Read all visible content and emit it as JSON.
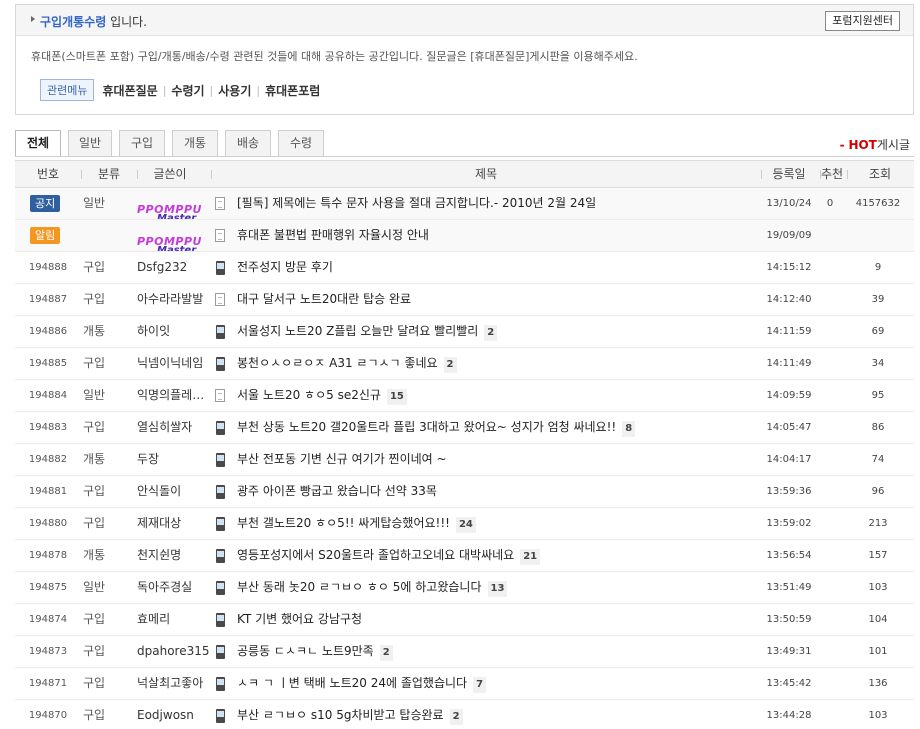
{
  "info": {
    "title_link": "구입개통수령",
    "title_suffix": " 입니다.",
    "forum_center_button": "포럼지원센터",
    "description": "휴대폰(스마트폰 포함) 구입/개통/배송/수령 관련된 것들에 대해 공유하는 공간입니다. 질문글은 [휴대폰질문]게시판을 이용해주세요.",
    "related_menu_label": "관련메뉴",
    "related_menu": [
      "휴대폰질문",
      "수령기",
      "사용기",
      "휴대폰포럼"
    ]
  },
  "tabs": [
    "전체",
    "일반",
    "구입",
    "개통",
    "배송",
    "수령"
  ],
  "hot": {
    "dash": "-",
    "hot": "HOT",
    "suffix": "게시글"
  },
  "columns": [
    "번호",
    "분류",
    "글쓴이",
    "제목",
    "등록일",
    "추천",
    "조회"
  ],
  "admin_logo": {
    "top": "PPOMPPU",
    "bottom": "Master"
  },
  "rows": [
    {
      "num_badge": "공지",
      "badge_type": "gongji",
      "category": "일반",
      "admin": true,
      "icon": "doc",
      "title": "[필독] 제목에는 특수 문자 사용을 절대 금지합니다.- 2010년 2월 24일",
      "comments": "",
      "date": "13/10/24",
      "rec": "0",
      "views": "4157632"
    },
    {
      "num_badge": "알림",
      "badge_type": "alrim",
      "category": "",
      "admin": true,
      "icon": "doc",
      "title": "휴대폰 불편법 판매행위 자율시정 안내",
      "comments": "",
      "date": "19/09/09",
      "rec": "",
      "views": ""
    },
    {
      "num": "194888",
      "category": "구입",
      "author": "Dsfg232",
      "icon": "phone",
      "title": "전주성지 방문 후기",
      "comments": "",
      "date": "14:15:12",
      "rec": "",
      "views": "9"
    },
    {
      "num": "194887",
      "category": "구입",
      "author": "아수라라발발",
      "icon": "doc",
      "title": "대구 달서구 노트20대란 탑승 완료",
      "comments": "",
      "date": "14:12:40",
      "rec": "",
      "views": "39"
    },
    {
      "num": "194886",
      "category": "개통",
      "author": "하이잇",
      "icon": "phone",
      "title": "서울성지 노트20 Z플립 오늘만 달려요 빨리빨리",
      "comments": "2",
      "date": "14:11:59",
      "rec": "",
      "views": "69"
    },
    {
      "num": "194885",
      "category": "구입",
      "author": "닉넴이닉네임",
      "icon": "phone",
      "title": "봉천ㅇㅅㅇㄹㅇㅈ A31 ㄹㄱㅅㄱ 좋네요",
      "comments": "2",
      "date": "14:11:49",
      "rec": "",
      "views": "34"
    },
    {
      "num": "194884",
      "category": "일반",
      "author": "익명의플레…",
      "icon": "doc",
      "title": "서울 노트20 ㅎㅇ5 se2신규",
      "comments": "15",
      "date": "14:09:59",
      "rec": "",
      "views": "95"
    },
    {
      "num": "194883",
      "category": "구입",
      "author": "열심히쌀자",
      "icon": "phone",
      "title": "부천 상동 노트20 갤20울트라 플립 3대하고 왔어요~ 성지가 엄청 싸네요!!",
      "comments": "8",
      "date": "14:05:47",
      "rec": "",
      "views": "86"
    },
    {
      "num": "194882",
      "category": "개통",
      "author": "두장",
      "icon": "phone",
      "title": "부산 전포동 기변 신규 여기가 찐이네여 ~",
      "comments": "",
      "date": "14:04:17",
      "rec": "",
      "views": "74"
    },
    {
      "num": "194881",
      "category": "구입",
      "author": "안식돌이",
      "icon": "phone",
      "title": "광주 아이폰 빵굽고 왔습니다 선약 33목",
      "comments": "",
      "date": "13:59:36",
      "rec": "",
      "views": "96"
    },
    {
      "num": "194880",
      "category": "구입",
      "author": "제재대상",
      "icon": "phone",
      "title": "부천 갤노트20 ㅎㅇ5!! 싸게탑승했어요!!!",
      "comments": "24",
      "date": "13:59:02",
      "rec": "",
      "views": "213"
    },
    {
      "num": "194878",
      "category": "개통",
      "author": "천지쉰명",
      "icon": "phone",
      "title": "영등포성지에서 S20울트라 졸업하고오네요 대박싸네요",
      "comments": "21",
      "date": "13:56:54",
      "rec": "",
      "views": "157"
    },
    {
      "num": "194875",
      "category": "일반",
      "author": "독아주경실",
      "icon": "phone",
      "title": "부산 동래 놋20 ㄹㄱㅂㅇ ㅎㅇ 5에 하고왔습니다",
      "comments": "13",
      "date": "13:51:49",
      "rec": "",
      "views": "103"
    },
    {
      "num": "194874",
      "category": "구입",
      "author": "효메리",
      "icon": "phone",
      "title": "KT 기변 했어요 강남구청",
      "comments": "",
      "date": "13:50:59",
      "rec": "",
      "views": "104"
    },
    {
      "num": "194873",
      "category": "구입",
      "author": "dpahore315",
      "icon": "phone",
      "title": "공릉동 ㄷㅅㅋㄴ 노트9만족",
      "comments": "2",
      "date": "13:49:31",
      "rec": "",
      "views": "101"
    },
    {
      "num": "194871",
      "category": "구입",
      "author": "넉살최고좋아",
      "icon": "phone",
      "title": "ㅅㅋ ㄱ ㅣ변 택배 노트20 24에 졸업했습니다",
      "comments": "7",
      "date": "13:45:42",
      "rec": "",
      "views": "136"
    },
    {
      "num": "194870",
      "category": "구입",
      "author": "Eodjwosn",
      "icon": "phone",
      "title": "부산 ㄹㄱㅂㅇ s10 5g차비받고 탑승완료",
      "comments": "2",
      "date": "13:44:28",
      "rec": "",
      "views": "103"
    }
  ]
}
